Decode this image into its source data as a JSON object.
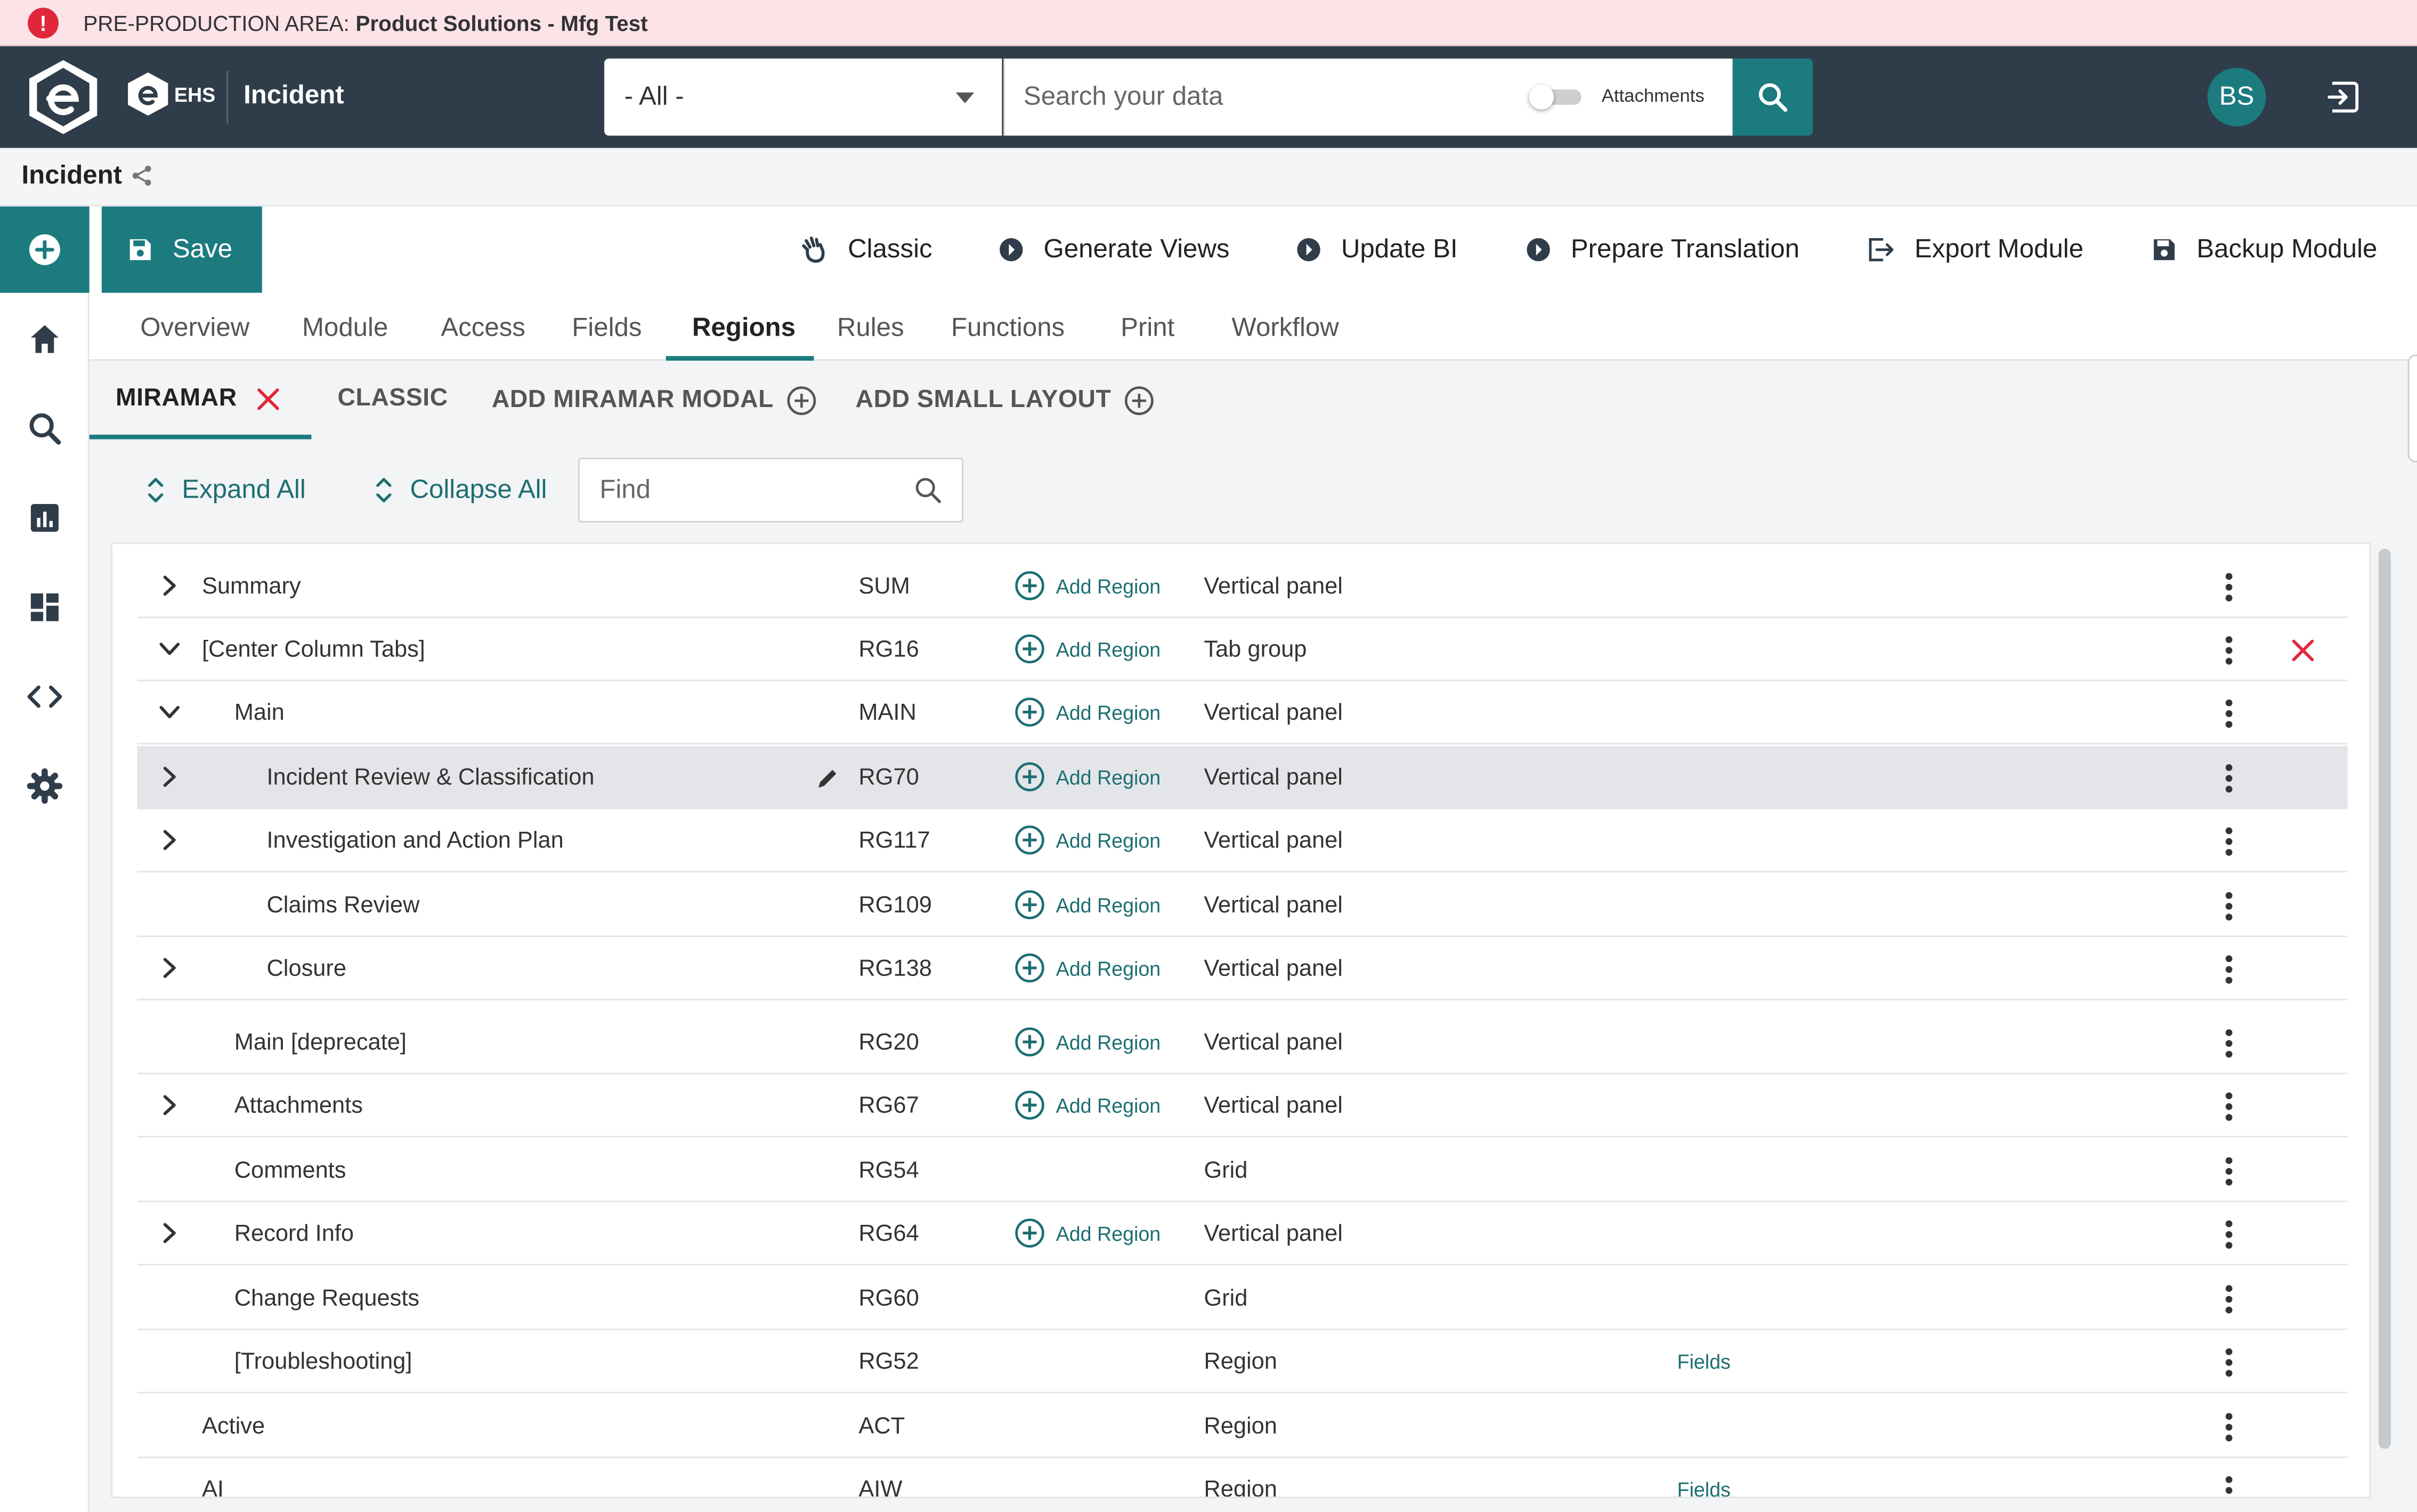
{
  "banner": {
    "prefix": "PRE-PRODUCTION AREA:",
    "env": "Product Solutions - Mfg Test"
  },
  "header": {
    "brand": "EHS",
    "app_title": "Incident",
    "scope_select": "- All -",
    "search_placeholder": "Search your data",
    "attachments_label": "Attachments",
    "attachments_on": false,
    "user_initials": "BS"
  },
  "breadcrumb": {
    "title": "Incident"
  },
  "toolbar": {
    "save_label": "Save",
    "actions": [
      "Classic",
      "Generate Views",
      "Update BI",
      "Prepare Translation",
      "Export Module",
      "Backup Module"
    ]
  },
  "tabs": {
    "items": [
      "Overview",
      "Module",
      "Access",
      "Fields",
      "Regions",
      "Rules",
      "Functions",
      "Print",
      "Workflow"
    ],
    "active": "Regions"
  },
  "layout_tabs": {
    "items": [
      "MIRAMAR",
      "CLASSIC",
      "ADD MIRAMAR MODAL",
      "ADD SMALL LAYOUT"
    ],
    "active": "MIRAMAR"
  },
  "controls": {
    "expand_all": "Expand All",
    "collapse_all": "Collapse All",
    "find_placeholder": "Find"
  },
  "regions": {
    "add_label": "Add Region",
    "fields_label": "Fields",
    "rows": [
      {
        "name": "Summary",
        "code": "SUM",
        "type": "Vertical panel"
      },
      {
        "name": "[Center Column Tabs]",
        "code": "RG16",
        "type": "Tab group"
      },
      {
        "name": "Main",
        "code": "MAIN",
        "type": "Vertical panel"
      },
      {
        "name": "Incident Review & Classification",
        "code": "RG70",
        "type": "Vertical panel"
      },
      {
        "name": "Investigation and Action Plan",
        "code": "RG117",
        "type": "Vertical panel"
      },
      {
        "name": "Claims Review",
        "code": "RG109",
        "type": "Vertical panel"
      },
      {
        "name": "Closure",
        "code": "RG138",
        "type": "Vertical panel"
      },
      {
        "name": "Main [deprecate]",
        "code": "RG20",
        "type": "Vertical panel"
      },
      {
        "name": "Attachments",
        "code": "RG67",
        "type": "Vertical panel"
      },
      {
        "name": "Comments",
        "code": "RG54",
        "type": "Grid"
      },
      {
        "name": "Record Info",
        "code": "RG64",
        "type": "Vertical panel"
      },
      {
        "name": "Change Requests",
        "code": "RG60",
        "type": "Grid"
      },
      {
        "name": "[Troubleshooting]",
        "code": "RG52",
        "type": "Region"
      },
      {
        "name": "Active",
        "code": "ACT",
        "type": "Region"
      },
      {
        "name": "AI",
        "code": "AIW",
        "type": "Region"
      }
    ]
  },
  "colors": {
    "accent": "#1c7b7f",
    "topbar": "#2f3d4a",
    "banner": "#fbe3e8",
    "alert": "#e0273a"
  }
}
